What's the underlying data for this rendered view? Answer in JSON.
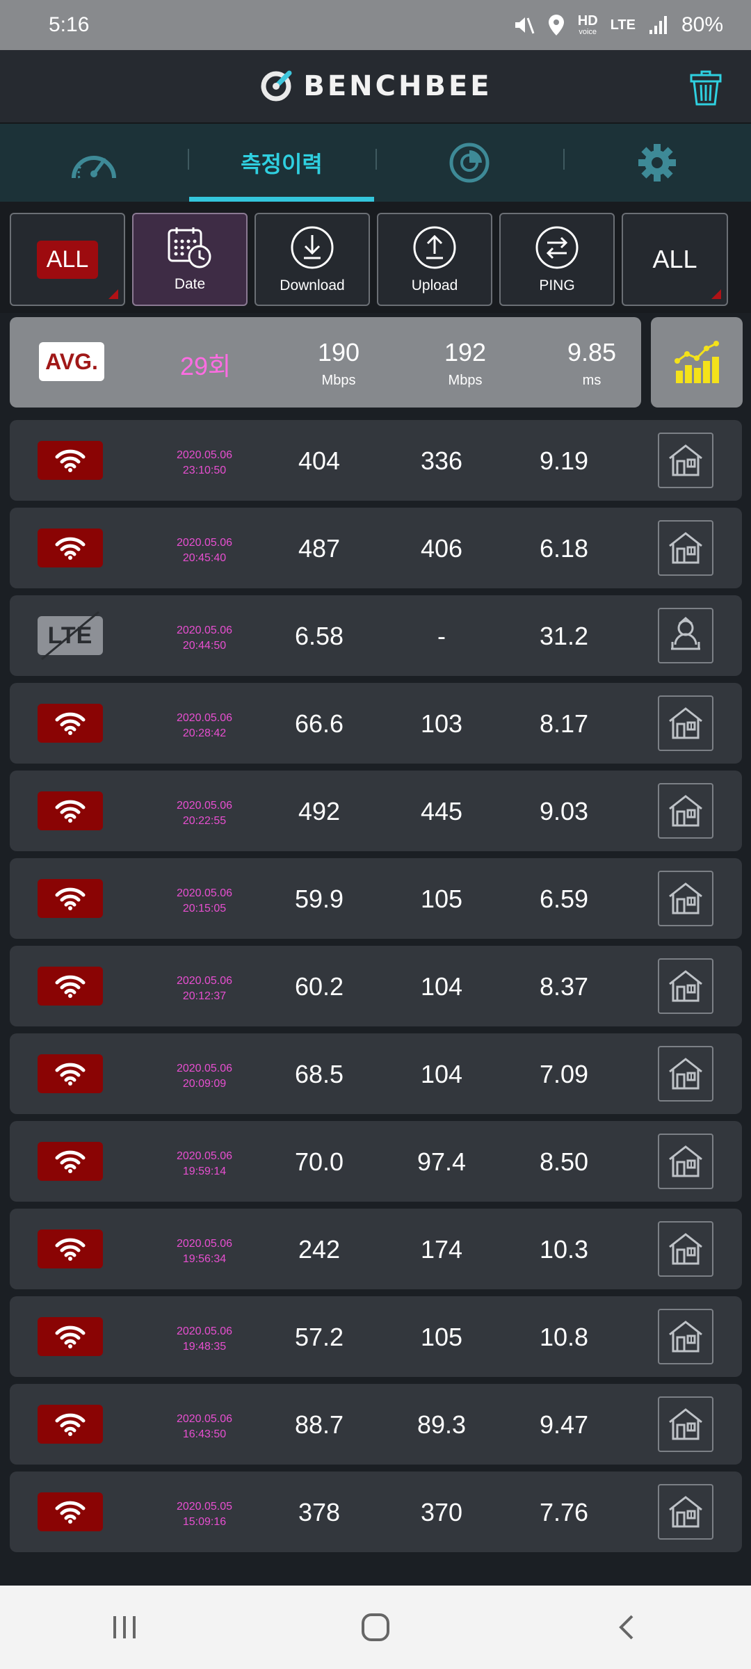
{
  "status_bar": {
    "time": "5:16",
    "hd": "HD",
    "voice": "voice",
    "network": "LTE",
    "battery": "80%"
  },
  "app": {
    "brand": "BENCHBEE",
    "trash_icon": "trash-icon",
    "accent": "#34c6dc"
  },
  "tabs": [
    {
      "icon": "speedometer-icon",
      "label": ""
    },
    {
      "icon": "",
      "label": "측정이력"
    },
    {
      "icon": "coverage-map-icon",
      "label": ""
    },
    {
      "icon": "gear-icon",
      "label": ""
    }
  ],
  "filters": {
    "network": "ALL",
    "date": "Date",
    "download": "Download",
    "upload": "Upload",
    "ping": "PING",
    "place": "ALL"
  },
  "average": {
    "badge": "AVG.",
    "count": "29회",
    "download": "190",
    "download_unit": "Mbps",
    "upload": "192",
    "upload_unit": "Mbps",
    "ping": "9.85",
    "ping_unit": "ms"
  },
  "results": [
    {
      "network": "wifi",
      "date": "2020.05.06",
      "time": "23:10:50",
      "download": "404",
      "upload": "336",
      "ping": "9.19",
      "place": "home"
    },
    {
      "network": "wifi",
      "date": "2020.05.06",
      "time": "20:45:40",
      "download": "487",
      "upload": "406",
      "ping": "6.18",
      "place": "home"
    },
    {
      "network": "lte",
      "date": "2020.05.06",
      "time": "20:44:50",
      "download": "6.58",
      "upload": "-",
      "ping": "31.2",
      "place": "person"
    },
    {
      "network": "wifi",
      "date": "2020.05.06",
      "time": "20:28:42",
      "download": "66.6",
      "upload": "103",
      "ping": "8.17",
      "place": "home"
    },
    {
      "network": "wifi",
      "date": "2020.05.06",
      "time": "20:22:55",
      "download": "492",
      "upload": "445",
      "ping": "9.03",
      "place": "home"
    },
    {
      "network": "wifi",
      "date": "2020.05.06",
      "time": "20:15:05",
      "download": "59.9",
      "upload": "105",
      "ping": "6.59",
      "place": "home"
    },
    {
      "network": "wifi",
      "date": "2020.05.06",
      "time": "20:12:37",
      "download": "60.2",
      "upload": "104",
      "ping": "8.37",
      "place": "home"
    },
    {
      "network": "wifi",
      "date": "2020.05.06",
      "time": "20:09:09",
      "download": "68.5",
      "upload": "104",
      "ping": "7.09",
      "place": "home"
    },
    {
      "network": "wifi",
      "date": "2020.05.06",
      "time": "19:59:14",
      "download": "70.0",
      "upload": "97.4",
      "ping": "8.50",
      "place": "home"
    },
    {
      "network": "wifi",
      "date": "2020.05.06",
      "time": "19:56:34",
      "download": "242",
      "upload": "174",
      "ping": "10.3",
      "place": "home"
    },
    {
      "network": "wifi",
      "date": "2020.05.06",
      "time": "19:48:35",
      "download": "57.2",
      "upload": "105",
      "ping": "10.8",
      "place": "home"
    },
    {
      "network": "wifi",
      "date": "2020.05.06",
      "time": "16:43:50",
      "download": "88.7",
      "upload": "89.3",
      "ping": "9.47",
      "place": "home"
    },
    {
      "network": "wifi",
      "date": "2020.05.05",
      "time": "15:09:16",
      "download": "378",
      "upload": "370",
      "ping": "7.76",
      "place": "home"
    }
  ],
  "lte_badge": "LTE",
  "nav": {
    "recent": "recent-apps-icon",
    "home": "home-icon",
    "back": "back-icon"
  }
}
